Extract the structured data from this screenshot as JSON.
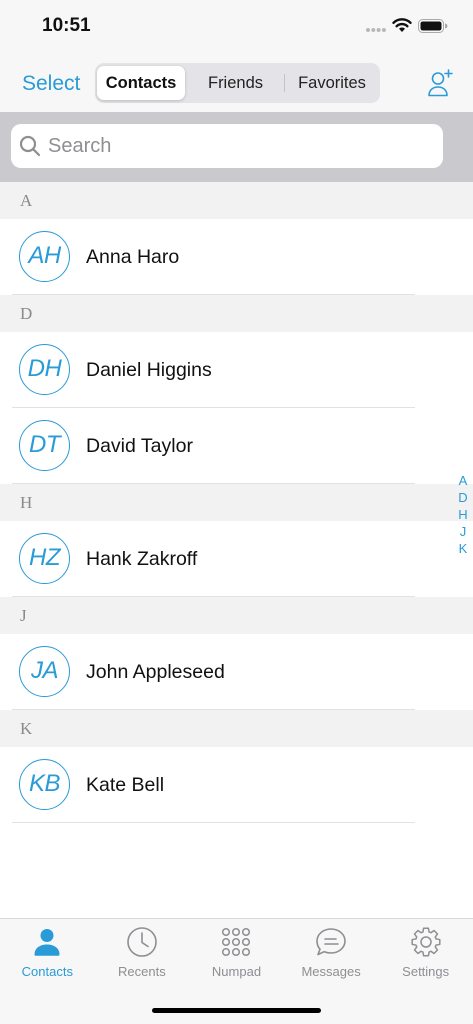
{
  "status_bar": {
    "time": "10:51",
    "icons": [
      "signal-dots-icon",
      "wifi-icon",
      "battery-icon"
    ]
  },
  "nav": {
    "select_label": "Select",
    "segments": [
      {
        "label": "Contacts",
        "selected": true
      },
      {
        "label": "Friends",
        "selected": false
      },
      {
        "label": "Favorites",
        "selected": false
      }
    ],
    "add_contact_icon": "add-person-icon"
  },
  "search": {
    "placeholder": "Search",
    "icon": "search-icon"
  },
  "sections": [
    {
      "letter": "A",
      "contacts": [
        {
          "initials": "AH",
          "name": "Anna Haro"
        }
      ]
    },
    {
      "letter": "D",
      "contacts": [
        {
          "initials": "DH",
          "name": "Daniel Higgins"
        },
        {
          "initials": "DT",
          "name": "David Taylor"
        }
      ]
    },
    {
      "letter": "H",
      "contacts": [
        {
          "initials": "HZ",
          "name": "Hank Zakroff"
        }
      ]
    },
    {
      "letter": "J",
      "contacts": [
        {
          "initials": "JA",
          "name": "John Appleseed"
        }
      ]
    },
    {
      "letter": "K",
      "contacts": [
        {
          "initials": "KB",
          "name": "Kate Bell"
        }
      ]
    }
  ],
  "index_letters": [
    "A",
    "D",
    "H",
    "J",
    "K"
  ],
  "tab_bar": {
    "tabs": [
      {
        "label": "Contacts",
        "icon": "person-icon",
        "active": true
      },
      {
        "label": "Recents",
        "icon": "clock-icon",
        "active": false
      },
      {
        "label": "Numpad",
        "icon": "numpad-icon",
        "active": false
      },
      {
        "label": "Messages",
        "icon": "chat-bubble-icon",
        "active": false
      },
      {
        "label": "Settings",
        "icon": "gear-icon",
        "active": false
      }
    ]
  },
  "colors": {
    "accent": "#299bd7",
    "section_header_bg": "#f2f2f2",
    "search_band_bg": "#c9c9ce",
    "inactive": "#8e8e93",
    "text": "#111111"
  }
}
